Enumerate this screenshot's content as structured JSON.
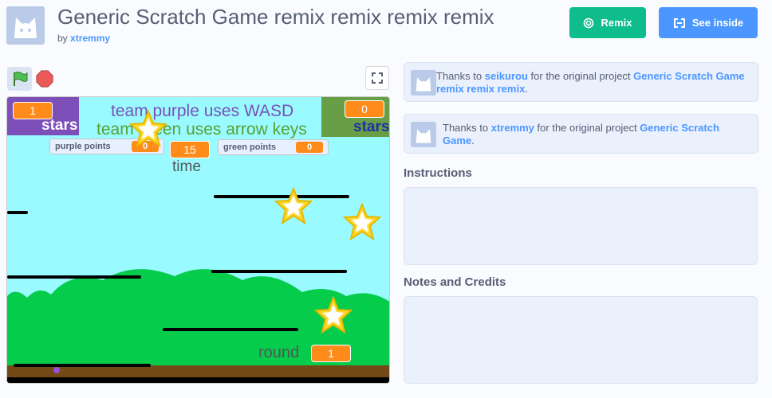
{
  "project": {
    "title": "Generic Scratch Game remix remix remix remix",
    "by_prefix": "by",
    "author": "xtremmy"
  },
  "buttons": {
    "remix_label": "Remix",
    "see_inside_label": "See inside"
  },
  "stage": {
    "purple_stars_value": "1",
    "purple_stars_label": "stars",
    "green_stars_value": "0",
    "green_stars_label": "stars",
    "team_purple_text": "team purple uses WASD",
    "team_green_text": "team green uses arrow keys",
    "purple_points_label": "purple points",
    "purple_points_value": "0",
    "green_points_label": "green points",
    "green_points_value": "0",
    "time_value": "15",
    "time_label": "time",
    "round_label": "round",
    "round_value": "1"
  },
  "credits": [
    {
      "prefix": "Thanks to",
      "user": "seikurou",
      "middle": "for the original project",
      "project": "Generic Scratch Game remix remix remix",
      "suffix": "."
    },
    {
      "prefix": "Thanks to",
      "user": "xtremmy",
      "middle": "for the original project",
      "project": "Generic Scratch Game",
      "suffix": "."
    }
  ],
  "sections": {
    "instructions": "Instructions",
    "notes": "Notes and Credits"
  },
  "colors": {
    "remix": "#0fbd8c",
    "see_inside": "#4c97ff",
    "team_purple": "#7d4fb8",
    "team_green": "#689e45",
    "sky": "#99fbff",
    "bush": "#05cc4b",
    "ground": "#734a16",
    "accent_link": "#4c97ff"
  },
  "icons": [
    "remix-icon",
    "see-inside-icon",
    "green-flag-icon",
    "stop-icon",
    "fullscreen-icon",
    "scratch-cat-avatar"
  ]
}
